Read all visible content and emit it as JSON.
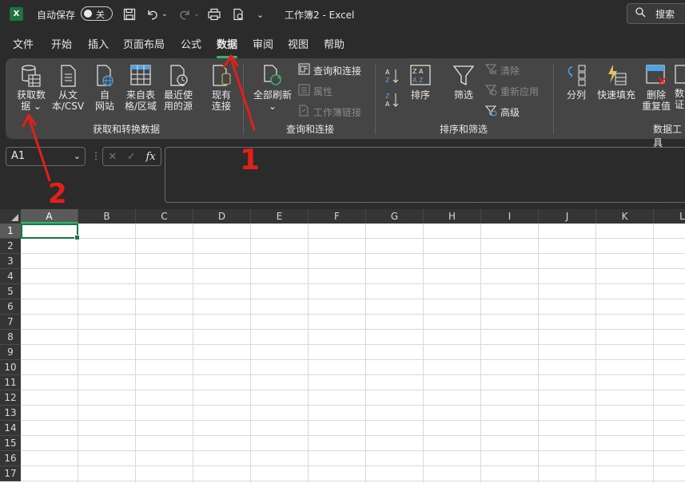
{
  "titlebar": {
    "autosave_label": "自动保存",
    "autosave_state": "关",
    "doc_title": "工作簿2 - Excel",
    "search_label": "搜索",
    "app_logo": "X"
  },
  "menu": {
    "items": [
      "文件",
      "开始",
      "插入",
      "页面布局",
      "公式",
      "数据",
      "审阅",
      "视图",
      "帮助"
    ],
    "active": "数据"
  },
  "ribbon": {
    "groups": {
      "get_transform": {
        "label": "获取和转换数据",
        "buttons": [
          {
            "line1": "获取数",
            "line2": "据 ⌄"
          },
          {
            "line1": "从文",
            "line2": "本/CSV"
          },
          {
            "line1": "自",
            "line2": "网站"
          },
          {
            "line1": "来自表",
            "line2": "格/区域"
          },
          {
            "line1": "最近使",
            "line2": "用的源"
          },
          {
            "line1": "现有",
            "line2": "连接"
          }
        ]
      },
      "queries": {
        "label": "查询和连接",
        "refresh_all": "全部刷新",
        "refresh_caret": "⌄",
        "queries_connections": "查询和连接",
        "properties": "属性",
        "workbook_links": "工作簿链接"
      },
      "sort_filter": {
        "label": "排序和筛选",
        "sort": "排序",
        "filter": "筛选",
        "clear": "清除",
        "reapply": "重新应用",
        "advanced": "高级"
      },
      "data_tools": {
        "label": "数据工具",
        "text_to_columns": "分列",
        "flash_fill": "快速填充",
        "remove_duplicates_1": "删除",
        "remove_duplicates_2": "重复值",
        "validation_1": "数",
        "validation_2": "证"
      }
    }
  },
  "formula_bar": {
    "name_box": "A1",
    "fx": "fx",
    "formula": ""
  },
  "grid": {
    "columns": [
      "A",
      "B",
      "C",
      "D",
      "E",
      "F",
      "G",
      "H",
      "I",
      "J",
      "K",
      "L"
    ],
    "rows": [
      "1",
      "2",
      "3",
      "4",
      "5",
      "6",
      "7",
      "8",
      "9",
      "10",
      "11",
      "12",
      "13",
      "14",
      "15",
      "16",
      "17"
    ],
    "active_cell": "A1"
  },
  "annotations": {
    "arrow1_label": "1",
    "arrow2_label": "2",
    "color": "#e0201b"
  },
  "colors": {
    "accent": "#3fae6a",
    "excel_green": "#1f7244",
    "ribbon_bg": "#454545",
    "window_bg": "#2b2b2b"
  }
}
